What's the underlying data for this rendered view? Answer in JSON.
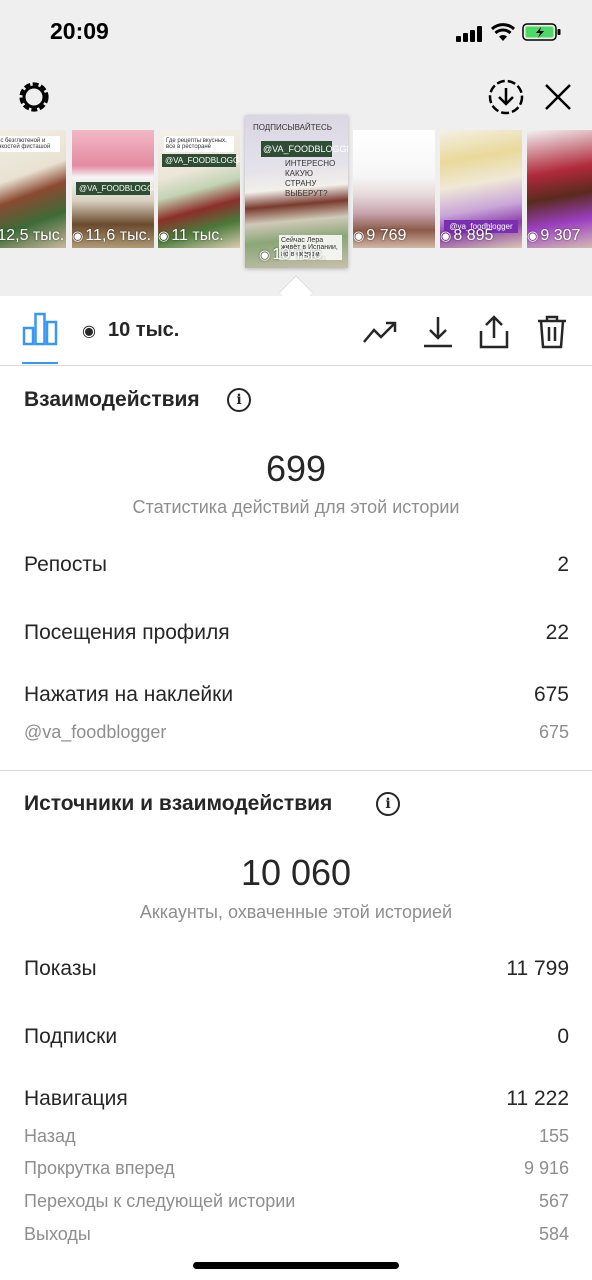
{
  "status_bar": {
    "time": "20:09"
  },
  "stories": [
    {
      "views": "12,5 тыс.",
      "note": "ер с безглютеной и тонкостей фисташой",
      "tag": ""
    },
    {
      "views": "11,6 тыс.",
      "note": "",
      "tag": "@VA_FOODBLOGGER"
    },
    {
      "views": "11 тыс.",
      "note": "Где рецепты вкусных, все в ресторане",
      "tag": "@VA_FOODBLOGGER"
    },
    {
      "views": "10 тыс.",
      "title": "ПОДПИСЫВАЙТЕСЬ",
      "tag": "@VA_FOODBLOGGER",
      "question": "ИНТЕРЕСНО КАКУЮ СТРАНУ ВЫБЕРУТ?",
      "caption": "Сейчас Лера живёт в Испании, но в скором"
    },
    {
      "views": "9 769",
      "tag": ""
    },
    {
      "views": "8 895",
      "tag": "@va_foodblogger"
    },
    {
      "views": "9 307",
      "tag": ""
    }
  ],
  "toolbar": {
    "view_count": "10 тыс."
  },
  "interactions": {
    "title": "Взаимодействия",
    "total": "699",
    "subtitle": "Статистика действий для этой истории",
    "rows": [
      {
        "label": "Репосты",
        "value": "2"
      },
      {
        "label": "Посещения профиля",
        "value": "22"
      },
      {
        "label": "Нажатия на наклейки",
        "value": "675"
      }
    ],
    "sticker": {
      "label": "@va_foodblogger",
      "value": "675"
    }
  },
  "discovery": {
    "title": "Источники и взаимодействия",
    "total": "10 060",
    "subtitle": "Аккаунты, охваченные этой историей",
    "rows": [
      {
        "label": "Показы",
        "value": "11 799"
      },
      {
        "label": "Подписки",
        "value": "0"
      },
      {
        "label": "Навигация",
        "value": "11 222"
      }
    ],
    "navigation": [
      {
        "label": "Назад",
        "value": "155"
      },
      {
        "label": "Прокрутка вперед",
        "value": "9 916"
      },
      {
        "label": "Переходы к следующей истории",
        "value": "567"
      },
      {
        "label": "Выходы",
        "value": "584"
      }
    ]
  },
  "colors": {
    "accent": "#3897f0",
    "tag_green": "#2f4d35",
    "secondary_text": "#8e8e8e"
  }
}
